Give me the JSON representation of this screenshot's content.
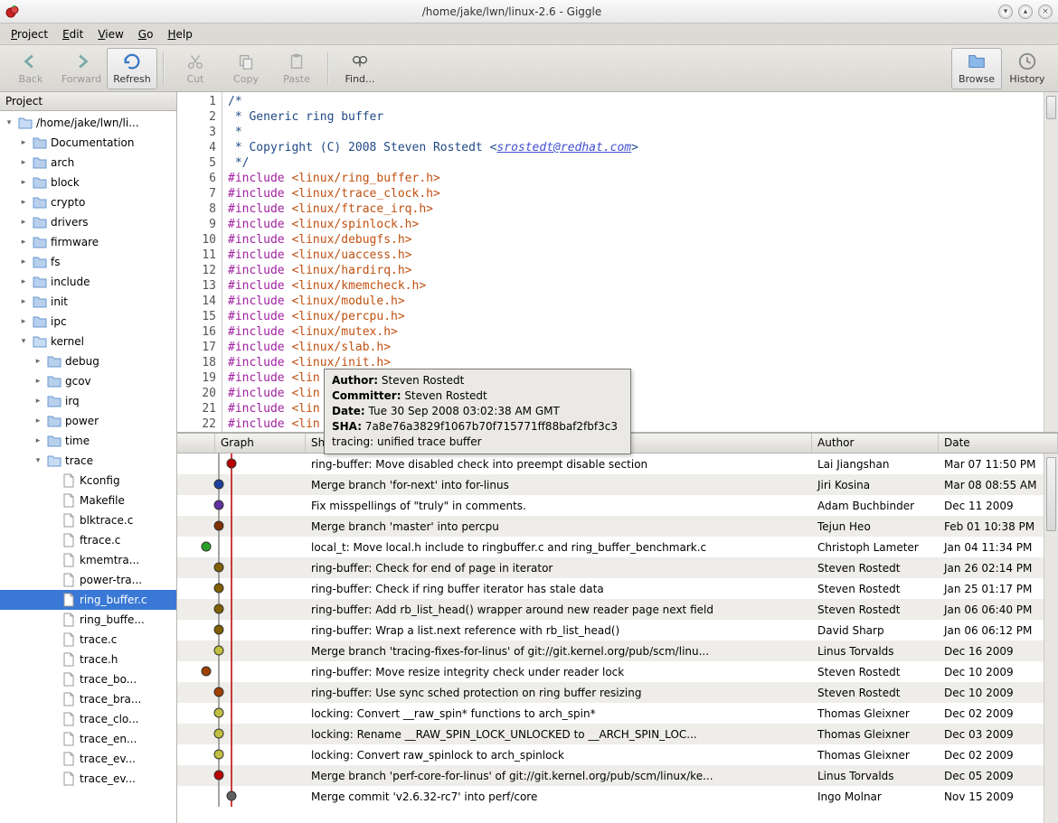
{
  "window": {
    "title": "/home/jake/lwn/linux-2.6 - Giggle"
  },
  "menus": {
    "project": "Project",
    "edit": "Edit",
    "view": "View",
    "go": "Go",
    "help": "Help"
  },
  "toolbar": {
    "back": "Back",
    "forward": "Forward",
    "refresh": "Refresh",
    "cut": "Cut",
    "copy": "Copy",
    "paste": "Paste",
    "find": "Find...",
    "browse": "Browse",
    "history": "History"
  },
  "sidebar": {
    "header": "Project",
    "root": "/home/jake/lwn/li...",
    "top_folders": [
      "Documentation",
      "arch",
      "block",
      "crypto",
      "drivers",
      "firmware",
      "fs",
      "include",
      "init",
      "ipc"
    ],
    "kernel": "kernel",
    "kernel_sub": [
      "debug",
      "gcov",
      "irq",
      "power",
      "time"
    ],
    "trace": "trace",
    "trace_files": [
      "Kconfig",
      "Makefile",
      "blktrace.c",
      "ftrace.c",
      "kmemtra...",
      "power-tra...",
      "ring_buffer.c",
      "ring_buffe...",
      "trace.c",
      "trace.h",
      "trace_bo...",
      "trace_bra...",
      "trace_clo...",
      "trace_en...",
      "trace_ev...",
      "trace_ev..."
    ],
    "selected": "ring_buffer.c"
  },
  "code": {
    "start_line": 1,
    "lines": [
      {
        "t": "comment",
        "s": "/*"
      },
      {
        "t": "comment",
        "s": " * Generic ring buffer"
      },
      {
        "t": "comment",
        "s": " *"
      },
      {
        "t": "copyright",
        "prefix": " * Copyright (C) 2008 Steven Rostedt <",
        "link": "srostedt@redhat.com",
        "suffix": ">"
      },
      {
        "t": "comment",
        "s": " */"
      },
      {
        "t": "include",
        "h": "linux/ring_buffer.h"
      },
      {
        "t": "include",
        "h": "linux/trace_clock.h"
      },
      {
        "t": "include",
        "h": "linux/ftrace_irq.h"
      },
      {
        "t": "include",
        "h": "linux/spinlock.h"
      },
      {
        "t": "include",
        "h": "linux/debugfs.h"
      },
      {
        "t": "include",
        "h": "linux/uaccess.h"
      },
      {
        "t": "include",
        "h": "linux/hardirq.h"
      },
      {
        "t": "include",
        "h": "linux/kmemcheck.h"
      },
      {
        "t": "include",
        "h": "linux/module.h"
      },
      {
        "t": "include",
        "h": "linux/percpu.h"
      },
      {
        "t": "include",
        "h": "linux/mutex.h"
      },
      {
        "t": "include",
        "h": "linux/slab.h"
      },
      {
        "t": "include",
        "h": "linux/init.h"
      },
      {
        "t": "include-trunc",
        "s": "#include <lin"
      },
      {
        "t": "include-trunc",
        "s": "#include <lin"
      },
      {
        "t": "include-trunc",
        "s": "#include <lin"
      },
      {
        "t": "include-trunc",
        "s": "#include <lin"
      }
    ]
  },
  "tooltip": {
    "author_label": "Author:",
    "author": " Steven Rostedt",
    "committer_label": "Committer:",
    "committer": " Steven Rostedt",
    "date_label": "Date:",
    "date": " Tue 30 Sep 2008 03:02:38 AM GMT",
    "sha_label": "SHA:",
    "sha": " 7a8e76a3829f1067b70f715771ff88baf2fbf3c3",
    "subject": "tracing: unified trace buffer"
  },
  "commits": {
    "headers": {
      "graph": "Graph",
      "log": "Short Log",
      "author": "Author",
      "date": "Date"
    },
    "rows": [
      {
        "log": "ring-buffer: Move disabled check into preempt disable section",
        "author": "Lai Jiangshan",
        "date": "Mar 07 11:50 PM",
        "color": "#b00",
        "x": 60
      },
      {
        "log": "Merge branch 'for-next' into for-linus",
        "author": "Jiri Kosina",
        "date": "Mar 08 08:55 AM",
        "color": "#2040a0",
        "x": 46
      },
      {
        "log": "Fix misspellings of \"truly\" in comments.",
        "author": "Adam Buchbinder",
        "date": "Dec 11 2009",
        "color": "#6030a0",
        "x": 46
      },
      {
        "log": "Merge branch 'master' into percpu",
        "author": "Tejun Heo",
        "date": "Feb 01 10:38 PM",
        "color": "#803000",
        "x": 46
      },
      {
        "log": "local_t: Move local.h include to ringbuffer.c and ring_buffer_benchmark.c",
        "author": "Christoph Lameter",
        "date": "Jan 04 11:34 PM",
        "color": "#2aa02a",
        "x": 32
      },
      {
        "log": "ring-buffer: Check for end of page in iterator",
        "author": "Steven Rostedt",
        "date": "Jan 26 02:14 PM",
        "color": "#806000",
        "x": 46
      },
      {
        "log": "ring-buffer: Check if ring buffer iterator has stale data",
        "author": "Steven Rostedt",
        "date": "Jan 25 01:17 PM",
        "color": "#806000",
        "x": 46
      },
      {
        "log": "ring-buffer: Add rb_list_head() wrapper around new reader page next field",
        "author": "Steven Rostedt",
        "date": "Jan 06 06:40 PM",
        "color": "#806000",
        "x": 46
      },
      {
        "log": "ring-buffer: Wrap a list.next reference with rb_list_head()",
        "author": "David Sharp",
        "date": "Jan 06 06:12 PM",
        "color": "#806000",
        "x": 46
      },
      {
        "log": "Merge branch 'tracing-fixes-for-linus' of git://git.kernel.org/pub/scm/linu...",
        "author": "Linus Torvalds",
        "date": "Dec 16 2009",
        "color": "#c0c040",
        "x": 46
      },
      {
        "log": "ring-buffer: Move resize integrity check under reader lock",
        "author": "Steven Rostedt",
        "date": "Dec 10 2009",
        "color": "#a04000",
        "x": 32
      },
      {
        "log": "ring-buffer: Use sync sched protection on ring buffer resizing",
        "author": "Steven Rostedt",
        "date": "Dec 10 2009",
        "color": "#a04000",
        "x": 46
      },
      {
        "log": "locking: Convert __raw_spin* functions to arch_spin*",
        "author": "Thomas Gleixner",
        "date": "Dec 02 2009",
        "color": "#c0c040",
        "x": 46
      },
      {
        "log": "locking: Rename __RAW_SPIN_LOCK_UNLOCKED to __ARCH_SPIN_LOC...",
        "author": "Thomas Gleixner",
        "date": "Dec 03 2009",
        "color": "#c0c040",
        "x": 46
      },
      {
        "log": "locking: Convert raw_spinlock to arch_spinlock",
        "author": "Thomas Gleixner",
        "date": "Dec 02 2009",
        "color": "#c0c040",
        "x": 46
      },
      {
        "log": "Merge branch 'perf-core-for-linus' of git://git.kernel.org/pub/scm/linux/ke...",
        "author": "Linus Torvalds",
        "date": "Dec 05 2009",
        "color": "#b00",
        "x": 46
      },
      {
        "log": "Merge commit 'v2.6.32-rc7' into perf/core",
        "author": "Ingo Molnar",
        "date": "Nov 15 2009",
        "color": "#606060",
        "x": 60
      }
    ]
  }
}
